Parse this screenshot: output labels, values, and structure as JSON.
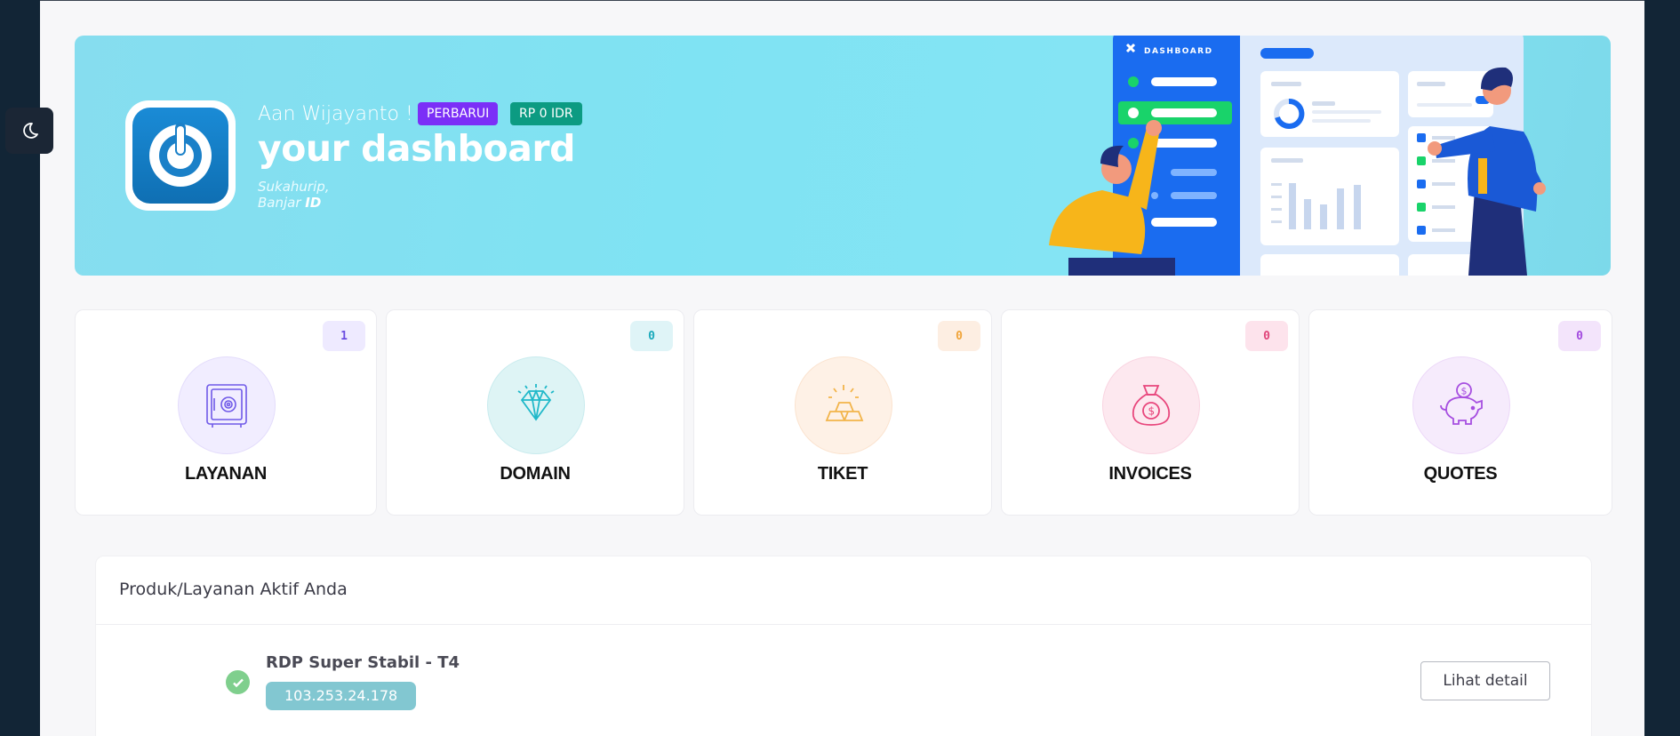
{
  "hero": {
    "greeting": "Aan Wijayanto !",
    "renew_badge": "PERBARUI",
    "balance_badge": "RP 0 IDR",
    "title": "your dashboard",
    "location_line1": "Sukahurip,",
    "location_city": "Banjar",
    "location_country": "ID",
    "illustration_label": "DASHBOARD"
  },
  "stats": [
    {
      "label": "LAYANAN",
      "count": "1",
      "icon": "safe-icon",
      "color": "#7b5cf0"
    },
    {
      "label": "DOMAIN",
      "count": "0",
      "icon": "diamond-icon",
      "color": "#1fb8c9"
    },
    {
      "label": "TIKET",
      "count": "0",
      "icon": "gold-bars-icon",
      "color": "#f2b44a"
    },
    {
      "label": "INVOICES",
      "count": "0",
      "icon": "money-bag-icon",
      "color": "#e8467c"
    },
    {
      "label": "QUOTES",
      "count": "0",
      "icon": "piggy-bank-icon",
      "color": "#a64ee0"
    }
  ],
  "active_services": {
    "title": "Produk/Layanan Aktif Anda",
    "items": [
      {
        "name": "RDP Super Stabil - T4",
        "ip": "103.253.24.178",
        "button": "Lihat detail",
        "status_color": "#7fcf8d"
      }
    ]
  },
  "colors": {
    "background": "#122536",
    "hero_start": "#86ddef",
    "renew": "#7b2ff7",
    "balance": "#0c9b82"
  }
}
